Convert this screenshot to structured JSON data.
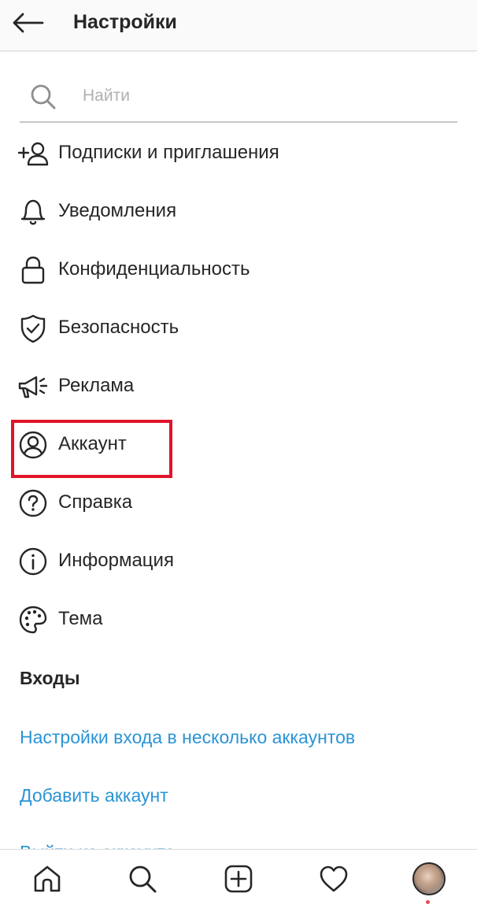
{
  "header": {
    "title": "Настройки",
    "back_icon": "arrow-left-icon"
  },
  "search": {
    "placeholder": "Найти",
    "value": "",
    "icon": "search-icon"
  },
  "menu": [
    {
      "label": "Подписки и приглашения",
      "icon": "add-person-icon"
    },
    {
      "label": "Уведомления",
      "icon": "bell-icon"
    },
    {
      "label": "Конфиденциальность",
      "icon": "lock-icon"
    },
    {
      "label": "Безопасность",
      "icon": "shield-check-icon"
    },
    {
      "label": "Реклама",
      "icon": "megaphone-icon"
    },
    {
      "label": "Аккаунт",
      "icon": "account-circle-icon"
    },
    {
      "label": "Справка",
      "icon": "help-circle-icon"
    },
    {
      "label": "Информация",
      "icon": "info-circle-icon"
    },
    {
      "label": "Тема",
      "icon": "palette-icon"
    }
  ],
  "logins": {
    "section_title": "Входы",
    "multi_account_link": "Настройки входа в несколько аккаунтов",
    "add_account_link": "Добавить аккаунт",
    "partial_link": "Выйти из аккаунта"
  },
  "bottom_nav": {
    "items": [
      "home-icon",
      "search-icon",
      "new-post-icon",
      "heart-icon",
      "profile-avatar"
    ]
  },
  "colors": {
    "link": "#2a94d6",
    "highlight": "#e0142a",
    "text": "#262626",
    "notification_dot": "#ed4956"
  }
}
